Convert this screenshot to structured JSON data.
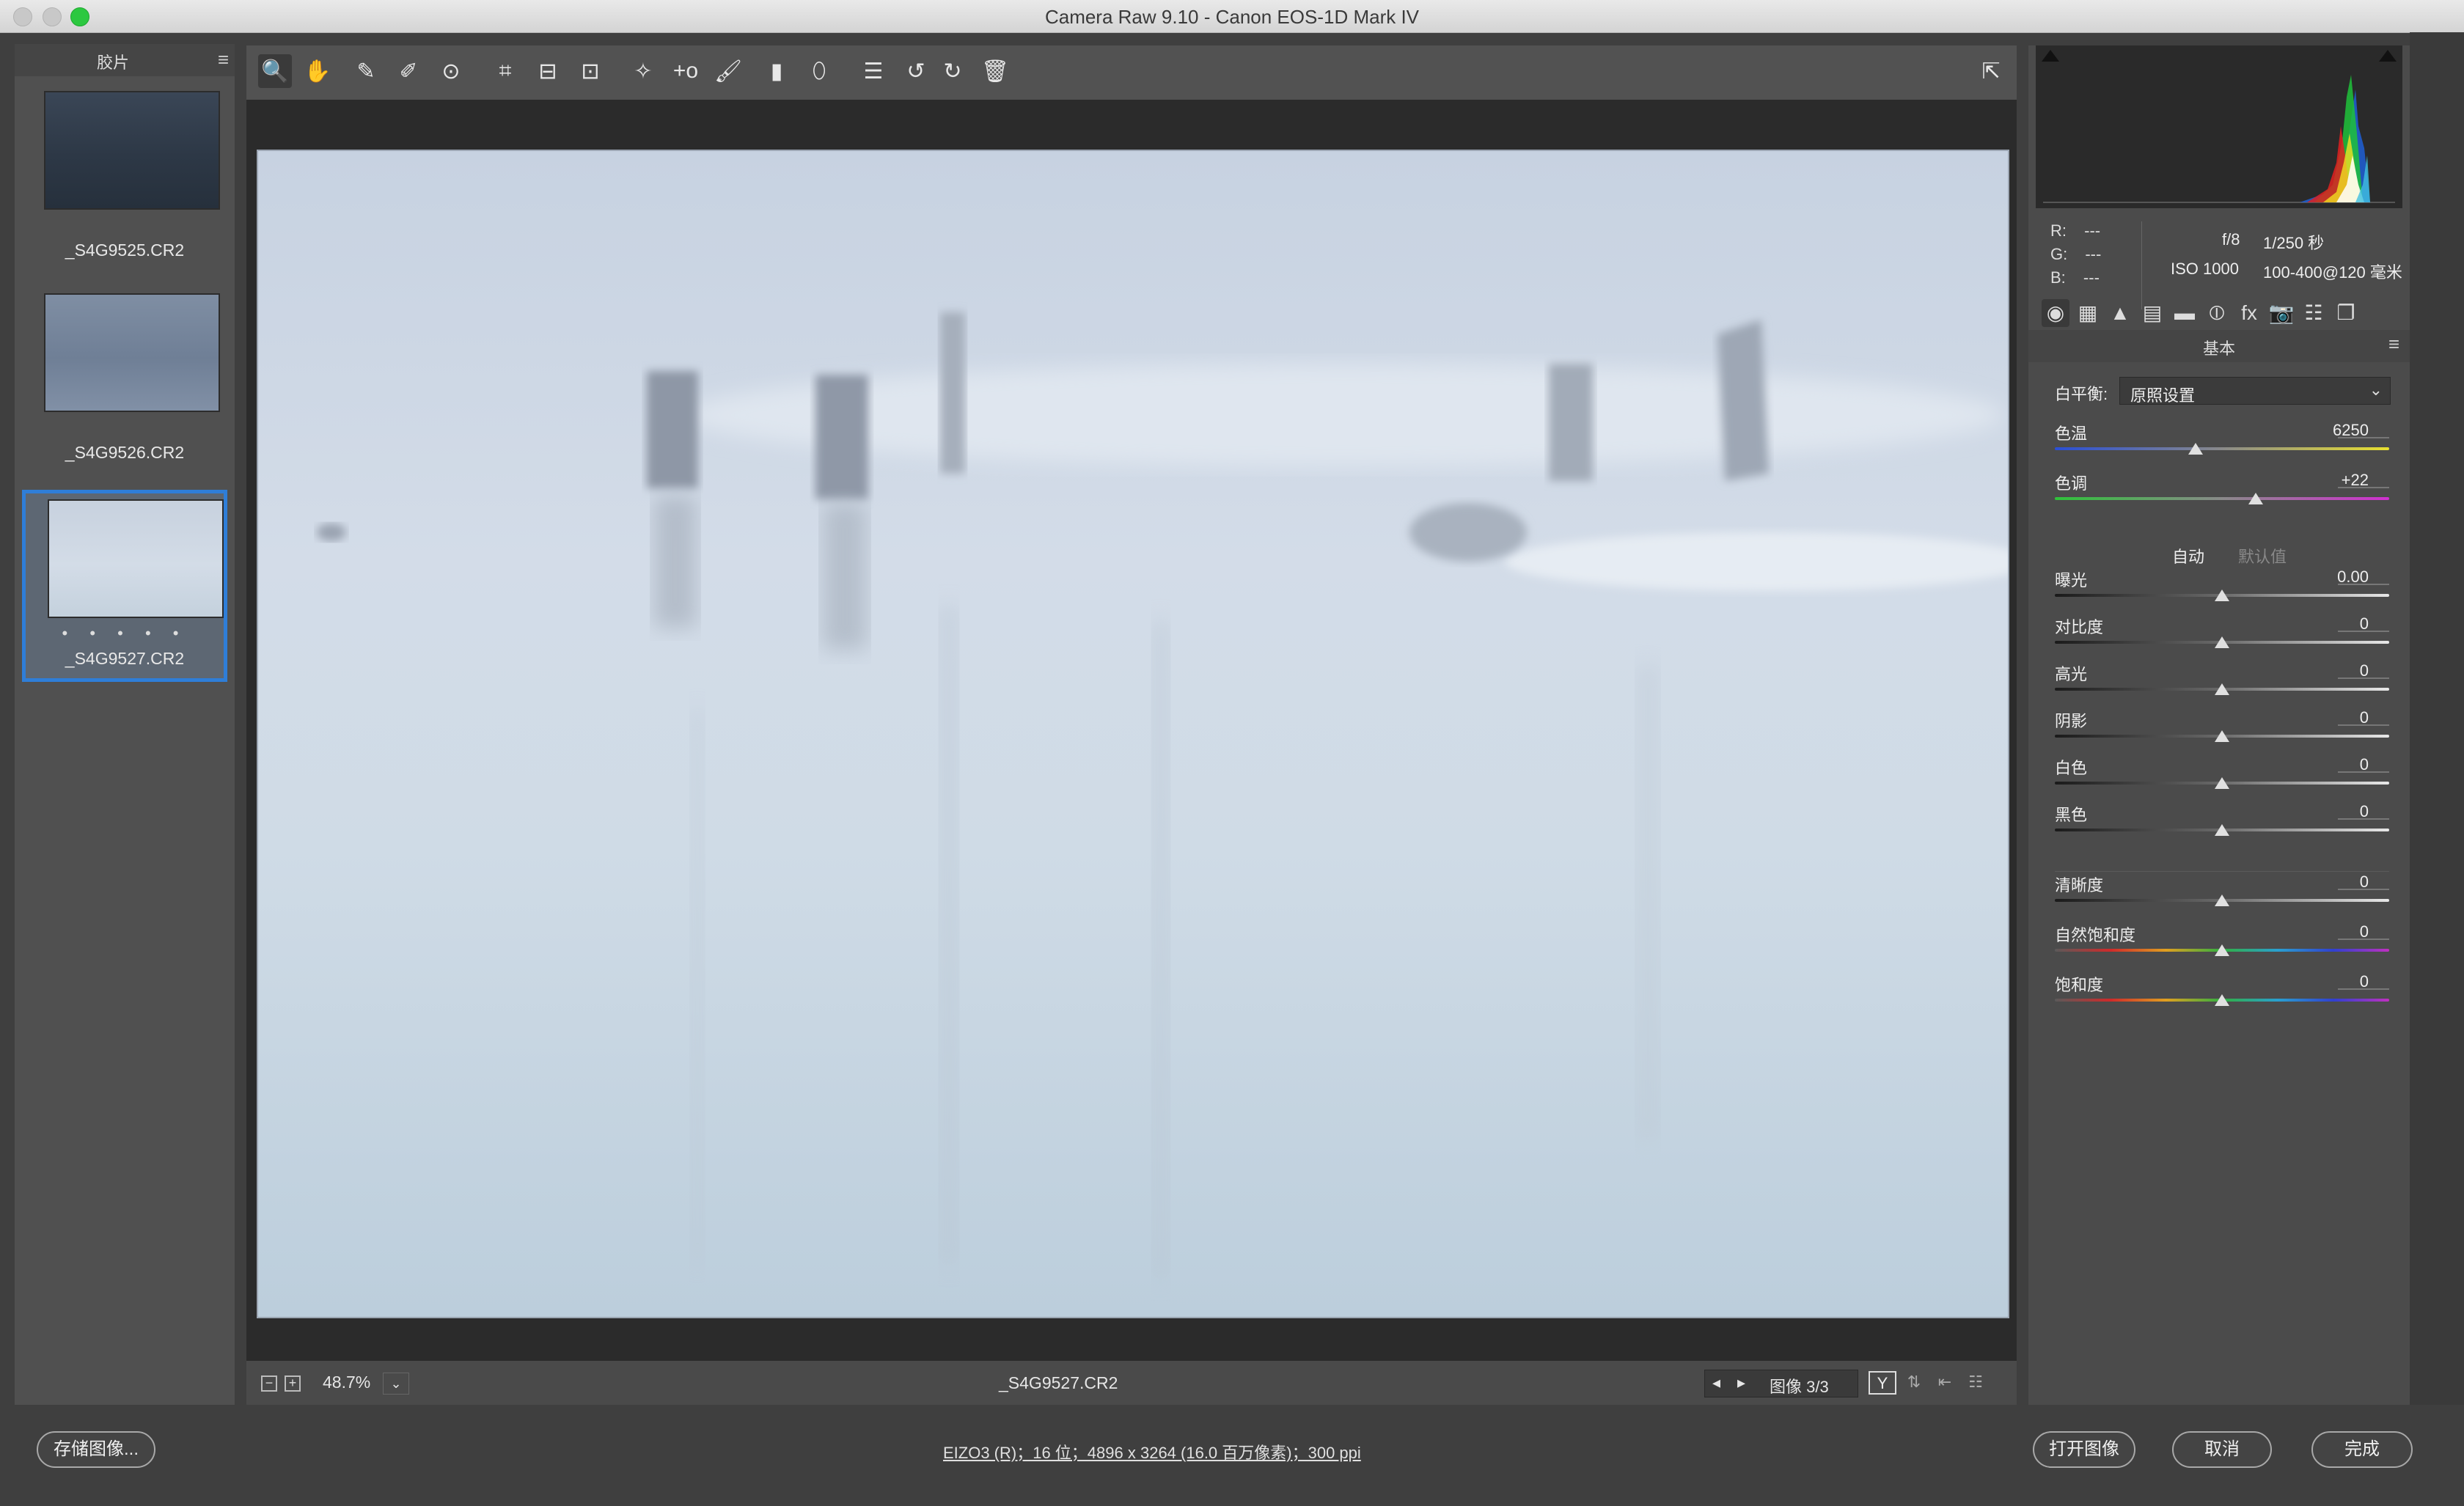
{
  "window": {
    "title": "Camera Raw 9.10 -  Canon EOS-1D Mark IV"
  },
  "filmstrip": {
    "title": "胶片",
    "menu_icon": "hamburger-icon",
    "items": [
      {
        "filename": "_S4G9525.CR2",
        "selected": false,
        "stars": ""
      },
      {
        "filename": "_S4G9526.CR2",
        "selected": false,
        "stars": ""
      },
      {
        "filename": "_S4G9527.CR2",
        "selected": true,
        "stars": "• • • • •"
      }
    ]
  },
  "toolbar": {
    "tools": [
      {
        "name": "zoom-tool",
        "icon": "magnifier-icon",
        "glyph": "🔍",
        "active": true
      },
      {
        "name": "hand-tool",
        "icon": "hand-icon",
        "glyph": "✋",
        "active": false
      },
      {
        "name": "white-balance-tool",
        "icon": "eyedropper-icon",
        "glyph": "✎",
        "active": false
      },
      {
        "name": "color-sampler-tool",
        "icon": "color-sampler-icon",
        "glyph": "✐",
        "active": false
      },
      {
        "name": "targeted-adjustment-tool",
        "icon": "target-adjust-icon",
        "glyph": "⊙",
        "active": false
      },
      {
        "name": "crop-tool",
        "icon": "crop-icon",
        "glyph": "⌗",
        "active": false
      },
      {
        "name": "straighten-tool",
        "icon": "straighten-icon",
        "glyph": "⊟",
        "active": false
      },
      {
        "name": "transform-tool",
        "icon": "transform-icon",
        "glyph": "⊡",
        "active": false
      },
      {
        "name": "spot-removal-tool",
        "icon": "spot-removal-icon",
        "glyph": "✧",
        "active": false
      },
      {
        "name": "red-eye-tool",
        "icon": "red-eye-icon",
        "glyph": "+o",
        "active": false
      },
      {
        "name": "adjustment-brush-tool",
        "icon": "brush-icon",
        "glyph": "🖌",
        "active": false
      },
      {
        "name": "graduated-filter-tool",
        "icon": "gradient-icon",
        "glyph": "▮",
        "active": false
      },
      {
        "name": "radial-filter-tool",
        "icon": "ellipse-icon",
        "glyph": "⬯",
        "active": false
      },
      {
        "name": "preferences-button",
        "icon": "list-icon",
        "glyph": "☰",
        "active": false
      },
      {
        "name": "rotate-left-button",
        "icon": "rotate-ccw-icon",
        "glyph": "↺",
        "active": false
      },
      {
        "name": "rotate-right-button",
        "icon": "rotate-cw-icon",
        "glyph": "↻",
        "active": false
      },
      {
        "name": "delete-button",
        "icon": "trash-icon",
        "glyph": "🗑",
        "active": false
      }
    ],
    "fullscreen_icon": "fullscreen-icon"
  },
  "status": {
    "zoom": "48.7%",
    "filename": "_S4G9527.CR2",
    "image_counter": "图像 3/3",
    "y_toggle": "Y"
  },
  "info": {
    "r_label": "R:",
    "r_value": "---",
    "g_label": "G:",
    "g_value": "---",
    "b_label": "B:",
    "b_value": "---",
    "aperture": "f/8",
    "shutter": "1/250 秒",
    "iso": "ISO 1000",
    "lens": "100-400@120 毫米"
  },
  "panel": {
    "title": "基本",
    "tabs": [
      {
        "name": "tab-basic",
        "icon": "aperture-icon",
        "glyph": "◉"
      },
      {
        "name": "tab-tone-curve",
        "icon": "curve-grid-icon",
        "glyph": "▦"
      },
      {
        "name": "tab-detail",
        "icon": "mountain-icon",
        "glyph": "▲"
      },
      {
        "name": "tab-hsl",
        "icon": "hsl-icon",
        "glyph": "▤"
      },
      {
        "name": "tab-split-toning",
        "icon": "split-tone-icon",
        "glyph": "▬"
      },
      {
        "name": "tab-lens",
        "icon": "lens-icon",
        "glyph": "⦶"
      },
      {
        "name": "tab-effects",
        "icon": "fx-icon",
        "glyph": "fx"
      },
      {
        "name": "tab-camera-calibration",
        "icon": "camera-icon",
        "glyph": "📷"
      },
      {
        "name": "tab-presets",
        "icon": "sliders-icon",
        "glyph": "☷"
      },
      {
        "name": "tab-snapshots",
        "icon": "snapshot-icon",
        "glyph": "❐"
      }
    ],
    "white_balance": {
      "label": "白平衡:",
      "value": "原照设置"
    },
    "auto_label": "自动",
    "default_label": "默认值",
    "sliders": [
      {
        "key": "temp",
        "label": "色温",
        "value": "6250",
        "pos": 0.42,
        "track": "temp"
      },
      {
        "key": "tint",
        "label": "色调",
        "value": "+22",
        "pos": 0.6,
        "track": "tint"
      },
      {
        "key": "exposure",
        "label": "曝光",
        "value": "0.00",
        "pos": 0.5,
        "track": "gray"
      },
      {
        "key": "contrast",
        "label": "对比度",
        "value": "0",
        "pos": 0.5,
        "track": "gray"
      },
      {
        "key": "highlights",
        "label": "高光",
        "value": "0",
        "pos": 0.5,
        "track": "gray"
      },
      {
        "key": "shadows",
        "label": "阴影",
        "value": "0",
        "pos": 0.5,
        "track": "gray"
      },
      {
        "key": "whites",
        "label": "白色",
        "value": "0",
        "pos": 0.5,
        "track": "gray"
      },
      {
        "key": "blacks",
        "label": "黑色",
        "value": "0",
        "pos": 0.5,
        "track": "gray"
      },
      {
        "key": "clarity",
        "label": "清晰度",
        "value": "0",
        "pos": 0.5,
        "track": "gray"
      },
      {
        "key": "vibrance",
        "label": "自然饱和度",
        "value": "0",
        "pos": 0.5,
        "track": "color"
      },
      {
        "key": "saturation",
        "label": "饱和度",
        "value": "0",
        "pos": 0.5,
        "track": "color"
      }
    ]
  },
  "bottom": {
    "save_label": "存储图像...",
    "workflow": "EIZO3 (R)；16 位；4896 x 3264 (16.0 百万像素)；300 ppi",
    "open_label": "打开图像",
    "cancel_label": "取消",
    "done_label": "完成"
  },
  "colors": {
    "selection": "#2f7ed8",
    "panel_bg": "#4b4b4b",
    "preview_bg": "#2b2b2b"
  }
}
